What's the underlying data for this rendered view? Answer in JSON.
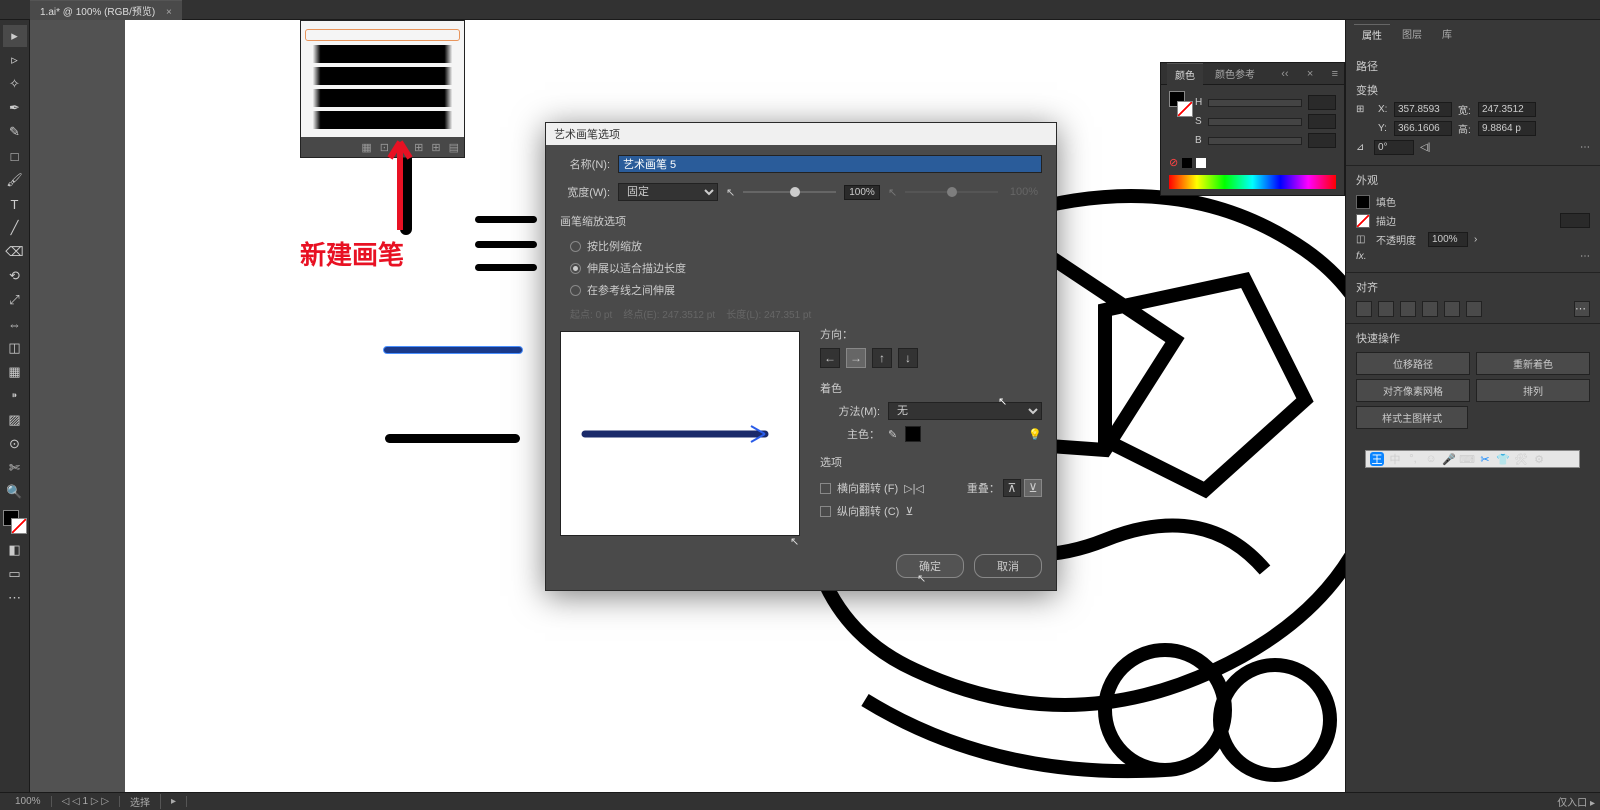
{
  "tab": {
    "title": "1.ai* @ 100% (RGB/预览)",
    "close": "×"
  },
  "annotation": {
    "label": "新建画笔"
  },
  "brush_panel": {
    "icons": [
      "▦",
      "⊡",
      "✕",
      "⊞",
      "⊞",
      "▤"
    ]
  },
  "dialog": {
    "title": "艺术画笔选项",
    "name_label": "名称(N):",
    "name_value": "艺术画笔 5",
    "width_label": "宽度(W):",
    "width_mode": "固定",
    "width_pct": "100%",
    "width_pct2": "100%",
    "scale_section": "画笔缩放选项",
    "scale_opts": [
      "按比例缩放",
      "伸展以适合描边长度",
      "在参考线之间伸展"
    ],
    "start_label": "起点:",
    "start_val": "0 pt",
    "end_label": "终点(E):",
    "end_val": "247.3512 pt",
    "len_label": "长度(L):",
    "len_val": "247.351 pt",
    "direction_label": "方向：",
    "color_section": "着色",
    "method_label": "方法(M):",
    "method_value": "无",
    "keycolor_label": "主色：",
    "options_section": "选项",
    "flip_h": "横向翻转 (F)",
    "flip_v": "纵向翻转 (C)",
    "overlap_label": "重叠：",
    "ok": "确定",
    "cancel": "取消"
  },
  "color_panel": {
    "tab1": "颜色",
    "tab2": "颜色参考",
    "labels": [
      "H",
      "S",
      "B"
    ],
    "nofill": "⊘"
  },
  "right": {
    "tabs": [
      "属性",
      "图层",
      "库"
    ],
    "path_label": "路径",
    "transform_label": "变换",
    "x": "357.8593",
    "w": "247.3512",
    "y": "366.1606",
    "h": "9.8864 p",
    "angle": "0°",
    "appearance_label": "外观",
    "fill_label": "填色",
    "stroke_label": "描边",
    "opacity_label": "不透明度",
    "opacity_val": "100%",
    "fx": "fx.",
    "align_label": "对齐",
    "quick_label": "快速操作",
    "btn1": "位移路径",
    "btn2": "重新着色",
    "btn3": "对齐像素网格",
    "btn4": "排列",
    "btn5": "样式主图样式"
  },
  "status": {
    "zoom": "100%",
    "nav": "1",
    "sel": "选择",
    "right": "仅入口 ▸"
  }
}
